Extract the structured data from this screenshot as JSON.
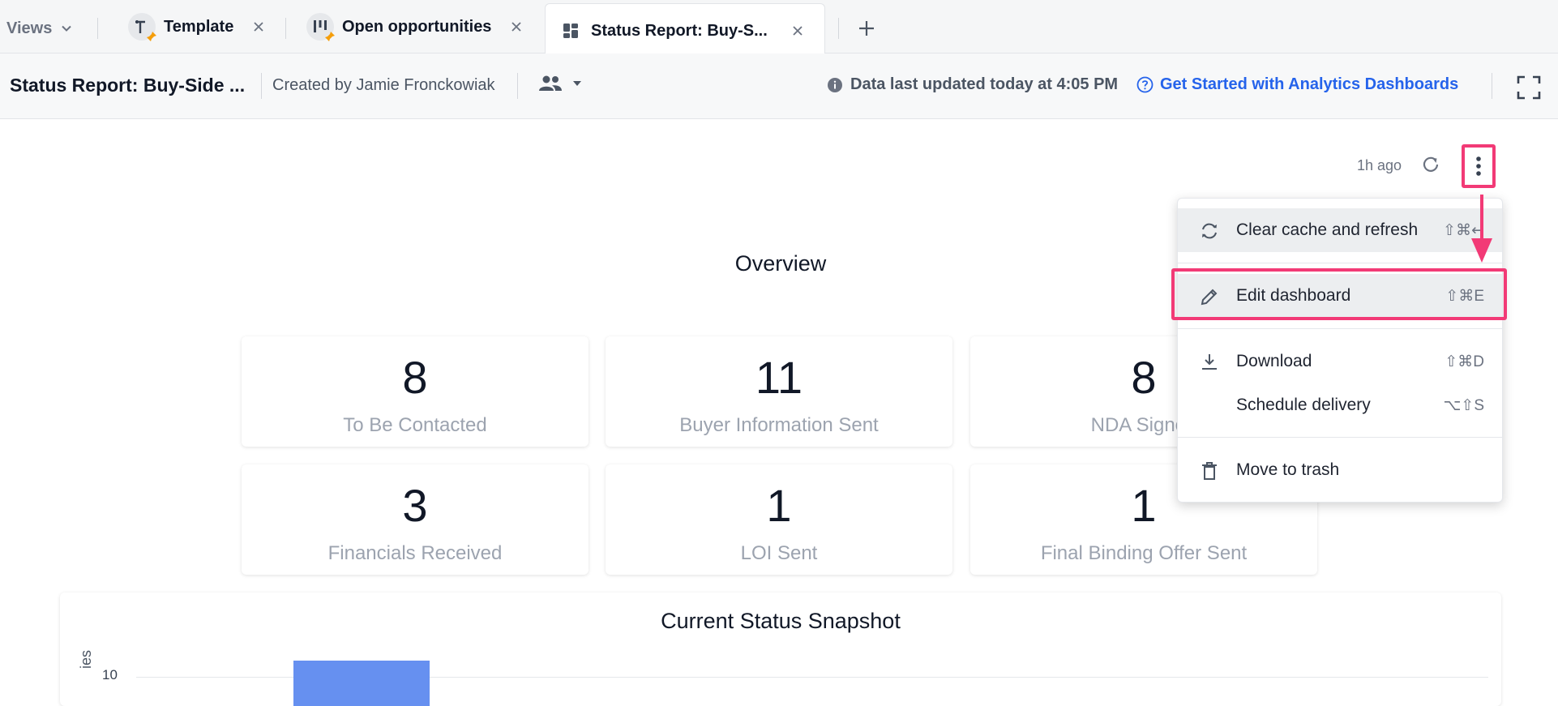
{
  "tabs": {
    "views_label": "Views",
    "items": [
      {
        "label": "Template"
      },
      {
        "label": "Open opportunities"
      },
      {
        "label": "Status Report: Buy-S..."
      }
    ]
  },
  "header": {
    "title": "Status Report: Buy-Side ...",
    "created_by": "Created by Jamie Fronckowiak",
    "updated": "Data last updated today at 4:05 PM",
    "help_link": "Get Started with Analytics Dashboards"
  },
  "toolbar": {
    "ago": "1h ago"
  },
  "overview": {
    "title": "Overview",
    "tiles": [
      {
        "value": "8",
        "label": "To Be Contacted"
      },
      {
        "value": "11",
        "label": "Buyer Information Sent"
      },
      {
        "value": "8",
        "label": "NDA Signed"
      },
      {
        "value": "3",
        "label": "Financials Received"
      },
      {
        "value": "1",
        "label": "LOI Sent"
      },
      {
        "value": "1",
        "label": "Final Binding Offer Sent"
      }
    ]
  },
  "snapshot": {
    "title": "Current Status Snapshot",
    "axis_tick": "10",
    "axis_label": "ies"
  },
  "menu": {
    "items": [
      {
        "label": "Clear cache and refresh",
        "shortcut": "⇧⌘↵",
        "icon": "refresh-icon"
      },
      {
        "label": "Edit dashboard",
        "shortcut": "⇧⌘E",
        "icon": "pencil-icon"
      },
      {
        "label": "Download",
        "shortcut": "⇧⌘D",
        "icon": "download-icon"
      },
      {
        "label": "Schedule delivery",
        "shortcut": "⌥⇧S",
        "icon": ""
      },
      {
        "label": "Move to trash",
        "shortcut": "",
        "icon": "trash-icon"
      }
    ]
  },
  "colors": {
    "accent": "#2563eb",
    "highlight": "#f23a76",
    "bar": "#6690f0",
    "pin": "#f59e0b"
  }
}
